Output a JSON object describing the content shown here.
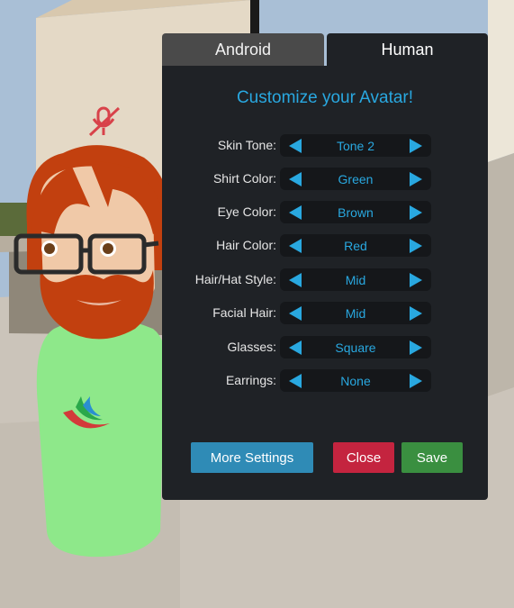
{
  "tabs": {
    "android": "Android",
    "human": "Human"
  },
  "panel": {
    "title": "Customize your Avatar!"
  },
  "options": [
    {
      "label": "Skin Tone:",
      "value": "Tone 2"
    },
    {
      "label": "Shirt Color:",
      "value": "Green"
    },
    {
      "label": "Eye Color:",
      "value": "Brown"
    },
    {
      "label": "Hair Color:",
      "value": "Red"
    },
    {
      "label": "Hair/Hat Style:",
      "value": "Mid"
    },
    {
      "label": "Facial Hair:",
      "value": "Mid"
    },
    {
      "label": "Glasses:",
      "value": "Square"
    },
    {
      "label": "Earrings:",
      "value": "None"
    }
  ],
  "buttons": {
    "more_settings": "More Settings",
    "close": "Close",
    "save": "Save"
  },
  "colors": {
    "accent": "#29a8e0",
    "panel": "#1f2226",
    "close": "#c4243f",
    "save": "#3a8f40",
    "more": "#2f8bb6",
    "shirt": "#8ee88a",
    "hair": "#c2400f"
  },
  "icons": {
    "mic_status": "muted-microphone-icon",
    "shirt_logo": "swoosh-logo-icon"
  }
}
